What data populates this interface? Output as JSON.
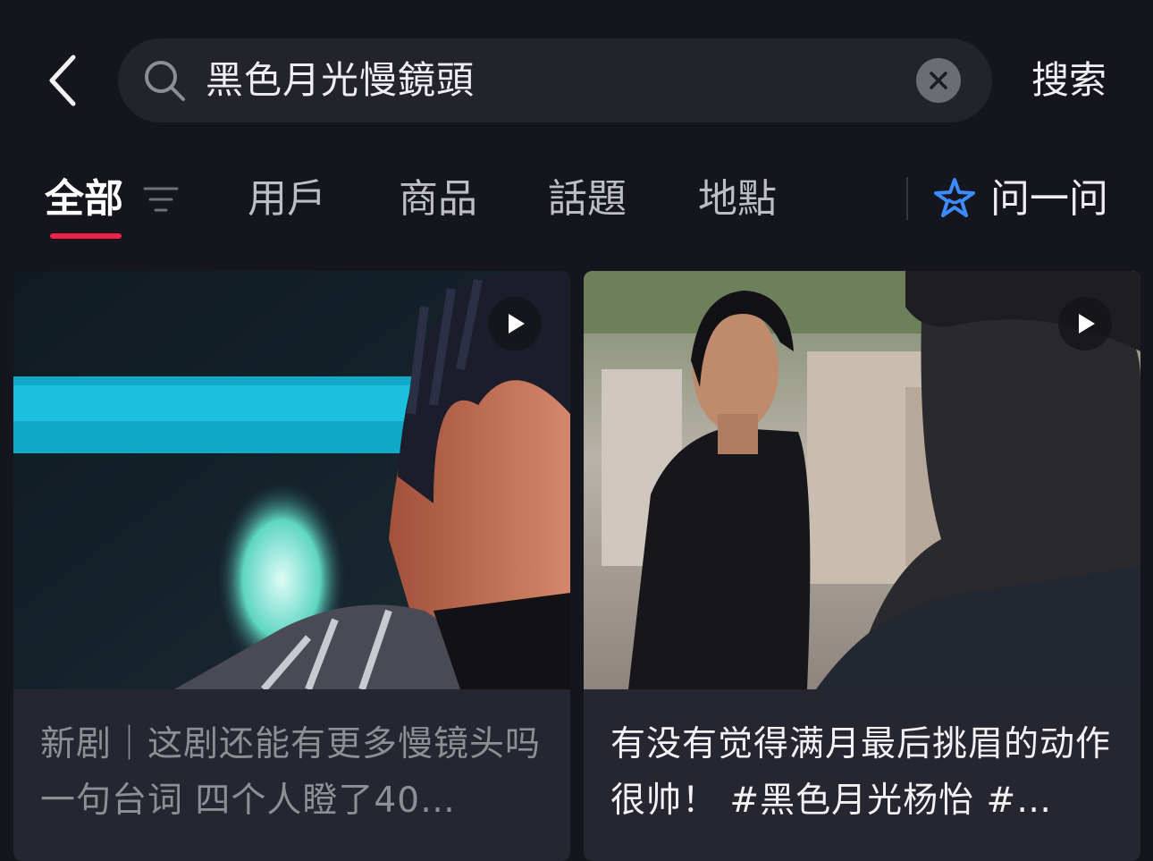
{
  "header": {
    "back_icon": "chevron-left-icon",
    "search": {
      "query": "黑色月光慢鏡頭",
      "search_icon": "search-icon",
      "clear_icon": "clear-icon"
    },
    "search_button_label": "搜索"
  },
  "tabs": [
    {
      "label": "全部",
      "active": true
    },
    {
      "label": "用戶",
      "active": false
    },
    {
      "label": "商品",
      "active": false
    },
    {
      "label": "話題",
      "active": false
    },
    {
      "label": "地點",
      "active": false
    }
  ],
  "filter_icon": "filter-icon",
  "ask": {
    "icon": "ai-star-icon",
    "label": "问一问",
    "color": "#3d8bff"
  },
  "accent_color": "#f0224a",
  "cards": [
    {
      "caption": "新剧｜这剧还能有更多慢镜头吗 一句台词 四个人瞪了40…",
      "caption_color": "#8e8e97",
      "play_icon": "play-icon"
    },
    {
      "caption": "有没有觉得满月最后挑眉的动作很帅！ #黑色月光杨怡 #…",
      "caption_color": "#f2f2f5",
      "play_icon": "play-icon"
    }
  ]
}
